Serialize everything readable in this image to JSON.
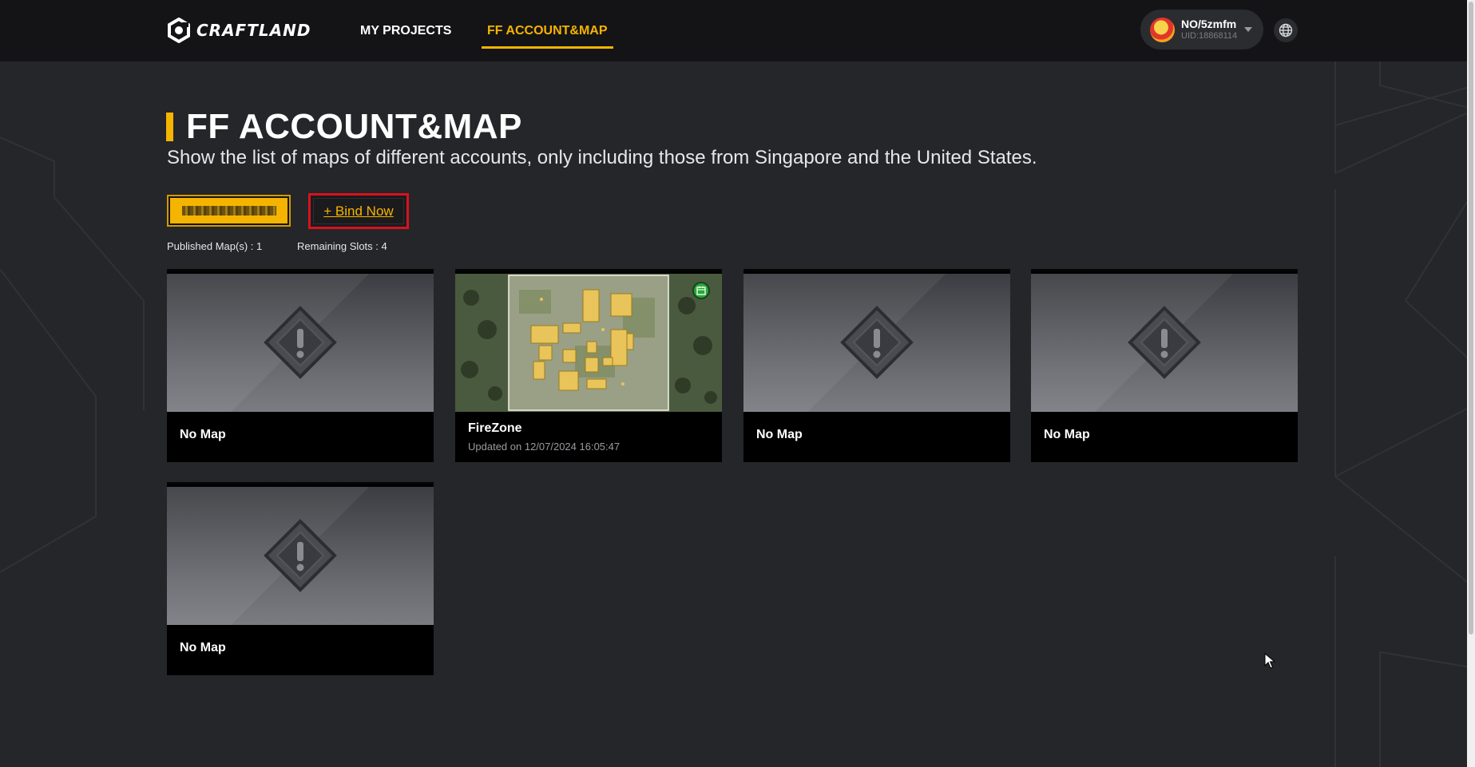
{
  "header": {
    "logo_text": "CRAFTLAND",
    "nav": [
      {
        "label": "MY PROJECTS",
        "active": false
      },
      {
        "label": "FF ACCOUNT&MAP",
        "active": true
      }
    ],
    "user": {
      "name": "NO/5zmfm",
      "uid": "UID:18868114"
    },
    "globe_icon": "globe-icon"
  },
  "main": {
    "title": "FF ACCOUNT&MAP",
    "description": "Show the list of maps of different accounts, only including those from Singapore and the United States.",
    "bind_button_label": "+ Bind Now",
    "published_maps": "Published Map(s) : 1",
    "remaining_slots": "Remaining Slots : 4"
  },
  "cards": [
    {
      "label": "No Map"
    },
    {
      "title": "FireZone",
      "subtitle": "Updated on 12/07/2024 16:05:47"
    },
    {
      "label": "No Map"
    },
    {
      "label": "No Map"
    },
    {
      "label": "No Map"
    }
  ],
  "colors": {
    "accent": "#f5b400",
    "background": "#25262a",
    "topbar": "#141416",
    "bind_border": "#d8121c"
  }
}
